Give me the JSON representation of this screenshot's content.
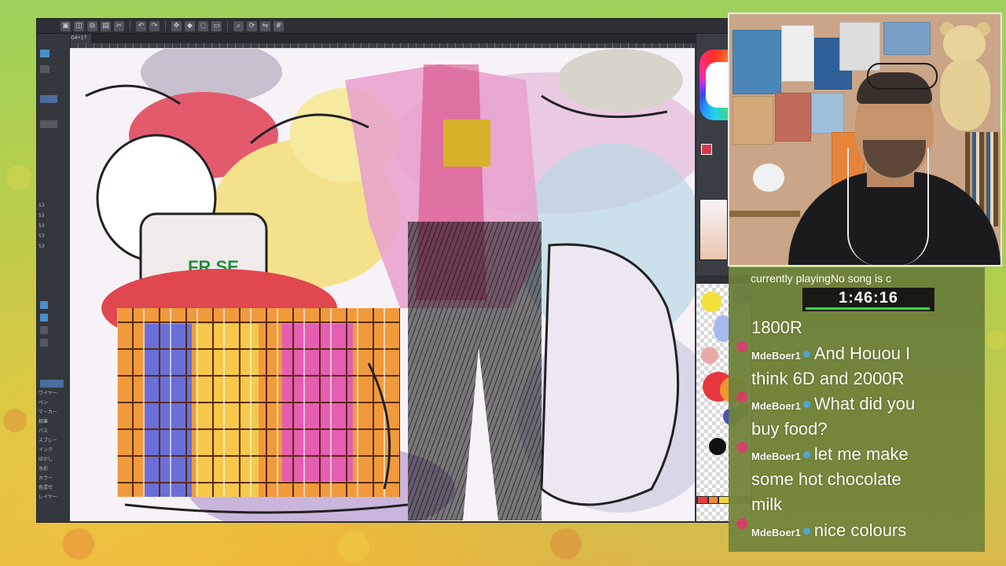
{
  "app": {
    "document_tab": "3604×1?",
    "left_panel_rows": [
      "53",
      "53",
      "53",
      "53",
      "53"
    ],
    "left_panel_labels": [
      "ワイヤー",
      "ペン",
      "マーカー",
      "鉛筆",
      "パス",
      "スプレー",
      "インク",
      "ぼかし",
      "水彩",
      "カラー",
      "色混ぜ",
      "レイヤー"
    ]
  },
  "stream": {
    "now_playing_label": "currently playingNo song is c",
    "timer": "1:46:16"
  },
  "chat": {
    "messages": [
      {
        "user": "",
        "text": "1800R"
      },
      {
        "user": "MdeBoer1",
        "text": "And Houou I"
      },
      {
        "user": "",
        "text": "think 6D and 2000R"
      },
      {
        "user": "MdeBoer1",
        "text": "What did you"
      },
      {
        "user": "",
        "text": "buy food?"
      },
      {
        "user": "MdeBoer1",
        "text": "let me make"
      },
      {
        "user": "",
        "text": "some hot chocolate"
      },
      {
        "user": "",
        "text": "milk"
      },
      {
        "user": "MdeBoer1",
        "text": "nice colours"
      }
    ]
  },
  "colors": {
    "accent_timer_bar": "#2fe02f",
    "badge": "#4aa3e0",
    "avatar": "#d23a66"
  },
  "icons": {
    "toolbar": [
      "file-icon",
      "save-icon",
      "undo-icon",
      "redo-icon",
      "cut-icon",
      "copy-icon",
      "paste-icon",
      "transform-icon",
      "fill-icon",
      "lasso-icon",
      "select-icon",
      "zoom-icon",
      "rotate-icon",
      "flip-icon",
      "grid-icon"
    ]
  }
}
